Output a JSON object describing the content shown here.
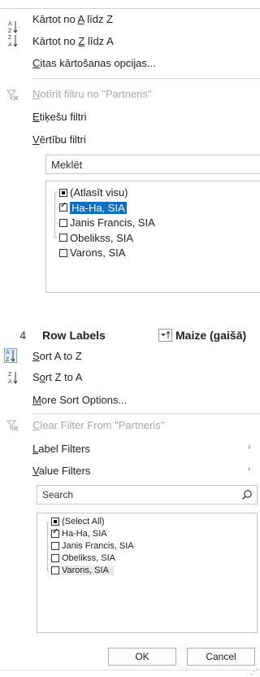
{
  "menu1": {
    "sort_az": {
      "before": "Kārtot no ",
      "u": "A",
      "after": " līdz Z"
    },
    "sort_za": {
      "before": "Kārtot no ",
      "u": "Z",
      "after": " līdz A"
    },
    "more_sort": {
      "before": "",
      "u": "C",
      "after": "itas kārtošanas opcijas..."
    },
    "clear_filter": {
      "before": "",
      "u": "N",
      "after": "otīrīt filtru no \"Partneris\""
    },
    "label_filters": {
      "before": "",
      "u": "E",
      "after": "tiķešu filtri"
    },
    "value_filters": {
      "before": "",
      "u": "V",
      "after": "ērtību filtri"
    },
    "search_placeholder": "Meklēt",
    "items": [
      {
        "label": "(Atlasīt visu)",
        "state": "indeterminate"
      },
      {
        "label": "Ha-Ha, SIA",
        "state": "checked",
        "selected": true
      },
      {
        "label": "Janis Francis, SIA",
        "state": "unchecked"
      },
      {
        "label": "Obelikss, SIA",
        "state": "unchecked"
      },
      {
        "label": "Varons, SIA",
        "state": "unchecked"
      }
    ]
  },
  "header": {
    "row_number": "4",
    "row_labels": "Row Labels",
    "column_label": "Maize (gaišā)"
  },
  "menu2": {
    "sort_az": {
      "before": "",
      "u": "S",
      "after": "ort A to Z"
    },
    "sort_za": {
      "before": "S",
      "u": "o",
      "after": "rt Z to A"
    },
    "more_sort": {
      "before": "",
      "u": "M",
      "after": "ore Sort Options..."
    },
    "clear_filter": {
      "before": "",
      "u": "C",
      "after": "lear Filter From \"Partneris\""
    },
    "label_filters": {
      "before": "",
      "u": "L",
      "after": "abel Filters"
    },
    "value_filters": {
      "before": "",
      "u": "V",
      "after": "alue Filters"
    },
    "search_placeholder": "Search",
    "items": [
      {
        "label": "(Select All)",
        "state": "indeterminate"
      },
      {
        "label": "Ha-Ha, SIA",
        "state": "checked"
      },
      {
        "label": "Janis Francis, SIA",
        "state": "unchecked"
      },
      {
        "label": "Obelikss, SIA",
        "state": "unchecked"
      },
      {
        "label": "Varons, SIA",
        "state": "unchecked",
        "hover": true
      }
    ],
    "ok_label": "OK",
    "cancel_label": "Cancel"
  },
  "colors": {
    "selection": "#0f6fc5",
    "sort_blue": "#1f5fbf",
    "disabled": "#a8a8a8"
  }
}
